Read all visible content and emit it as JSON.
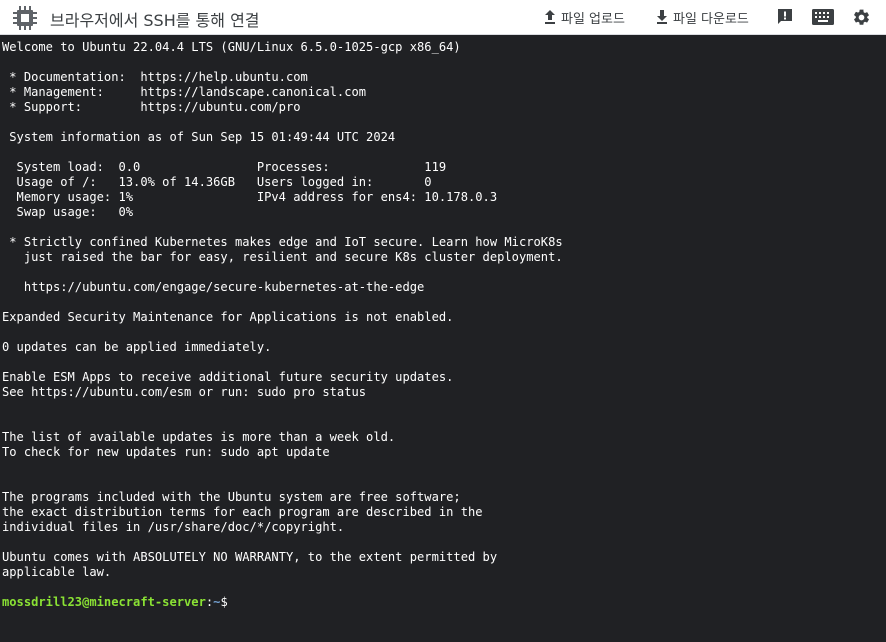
{
  "header": {
    "title": "브라우저에서 SSH를 통해 연결",
    "upload_label": "파일 업로드",
    "download_label": "파일 다운로드",
    "icons": [
      "chip-icon",
      "upload-icon",
      "download-icon",
      "feedback-icon",
      "keyboard-icon",
      "gear-icon"
    ]
  },
  "terminal": {
    "lines": [
      "Welcome to Ubuntu 22.04.4 LTS (GNU/Linux 6.5.0-1025-gcp x86_64)",
      "",
      " * Documentation:  https://help.ubuntu.com",
      " * Management:     https://landscape.canonical.com",
      " * Support:        https://ubuntu.com/pro",
      "",
      " System information as of Sun Sep 15 01:49:44 UTC 2024",
      "",
      "  System load:  0.0                Processes:             119",
      "  Usage of /:   13.0% of 14.36GB   Users logged in:       0",
      "  Memory usage: 1%                 IPv4 address for ens4: 10.178.0.3",
      "  Swap usage:   0%",
      "",
      " * Strictly confined Kubernetes makes edge and IoT secure. Learn how MicroK8s",
      "   just raised the bar for easy, resilient and secure K8s cluster deployment.",
      "",
      "   https://ubuntu.com/engage/secure-kubernetes-at-the-edge",
      "",
      "Expanded Security Maintenance for Applications is not enabled.",
      "",
      "0 updates can be applied immediately.",
      "",
      "Enable ESM Apps to receive additional future security updates.",
      "See https://ubuntu.com/esm or run: sudo pro status",
      "",
      "",
      "The list of available updates is more than a week old.",
      "To check for new updates run: sudo apt update",
      "",
      "",
      "The programs included with the Ubuntu system are free software;",
      "the exact distribution terms for each program are described in the",
      "individual files in /usr/share/doc/*/copyright.",
      "",
      "Ubuntu comes with ABSOLUTELY NO WARRANTY, to the extent permitted by",
      "applicable law.",
      ""
    ],
    "prompt_user": "mossdrill23@minecraft-server",
    "prompt_sep": ":",
    "prompt_path": "~",
    "prompt_symbol": "$",
    "colors": {
      "background": "#202124",
      "text": "#ffffff",
      "prompt_user": "#8ae234",
      "prompt_path": "#729fcf"
    }
  }
}
